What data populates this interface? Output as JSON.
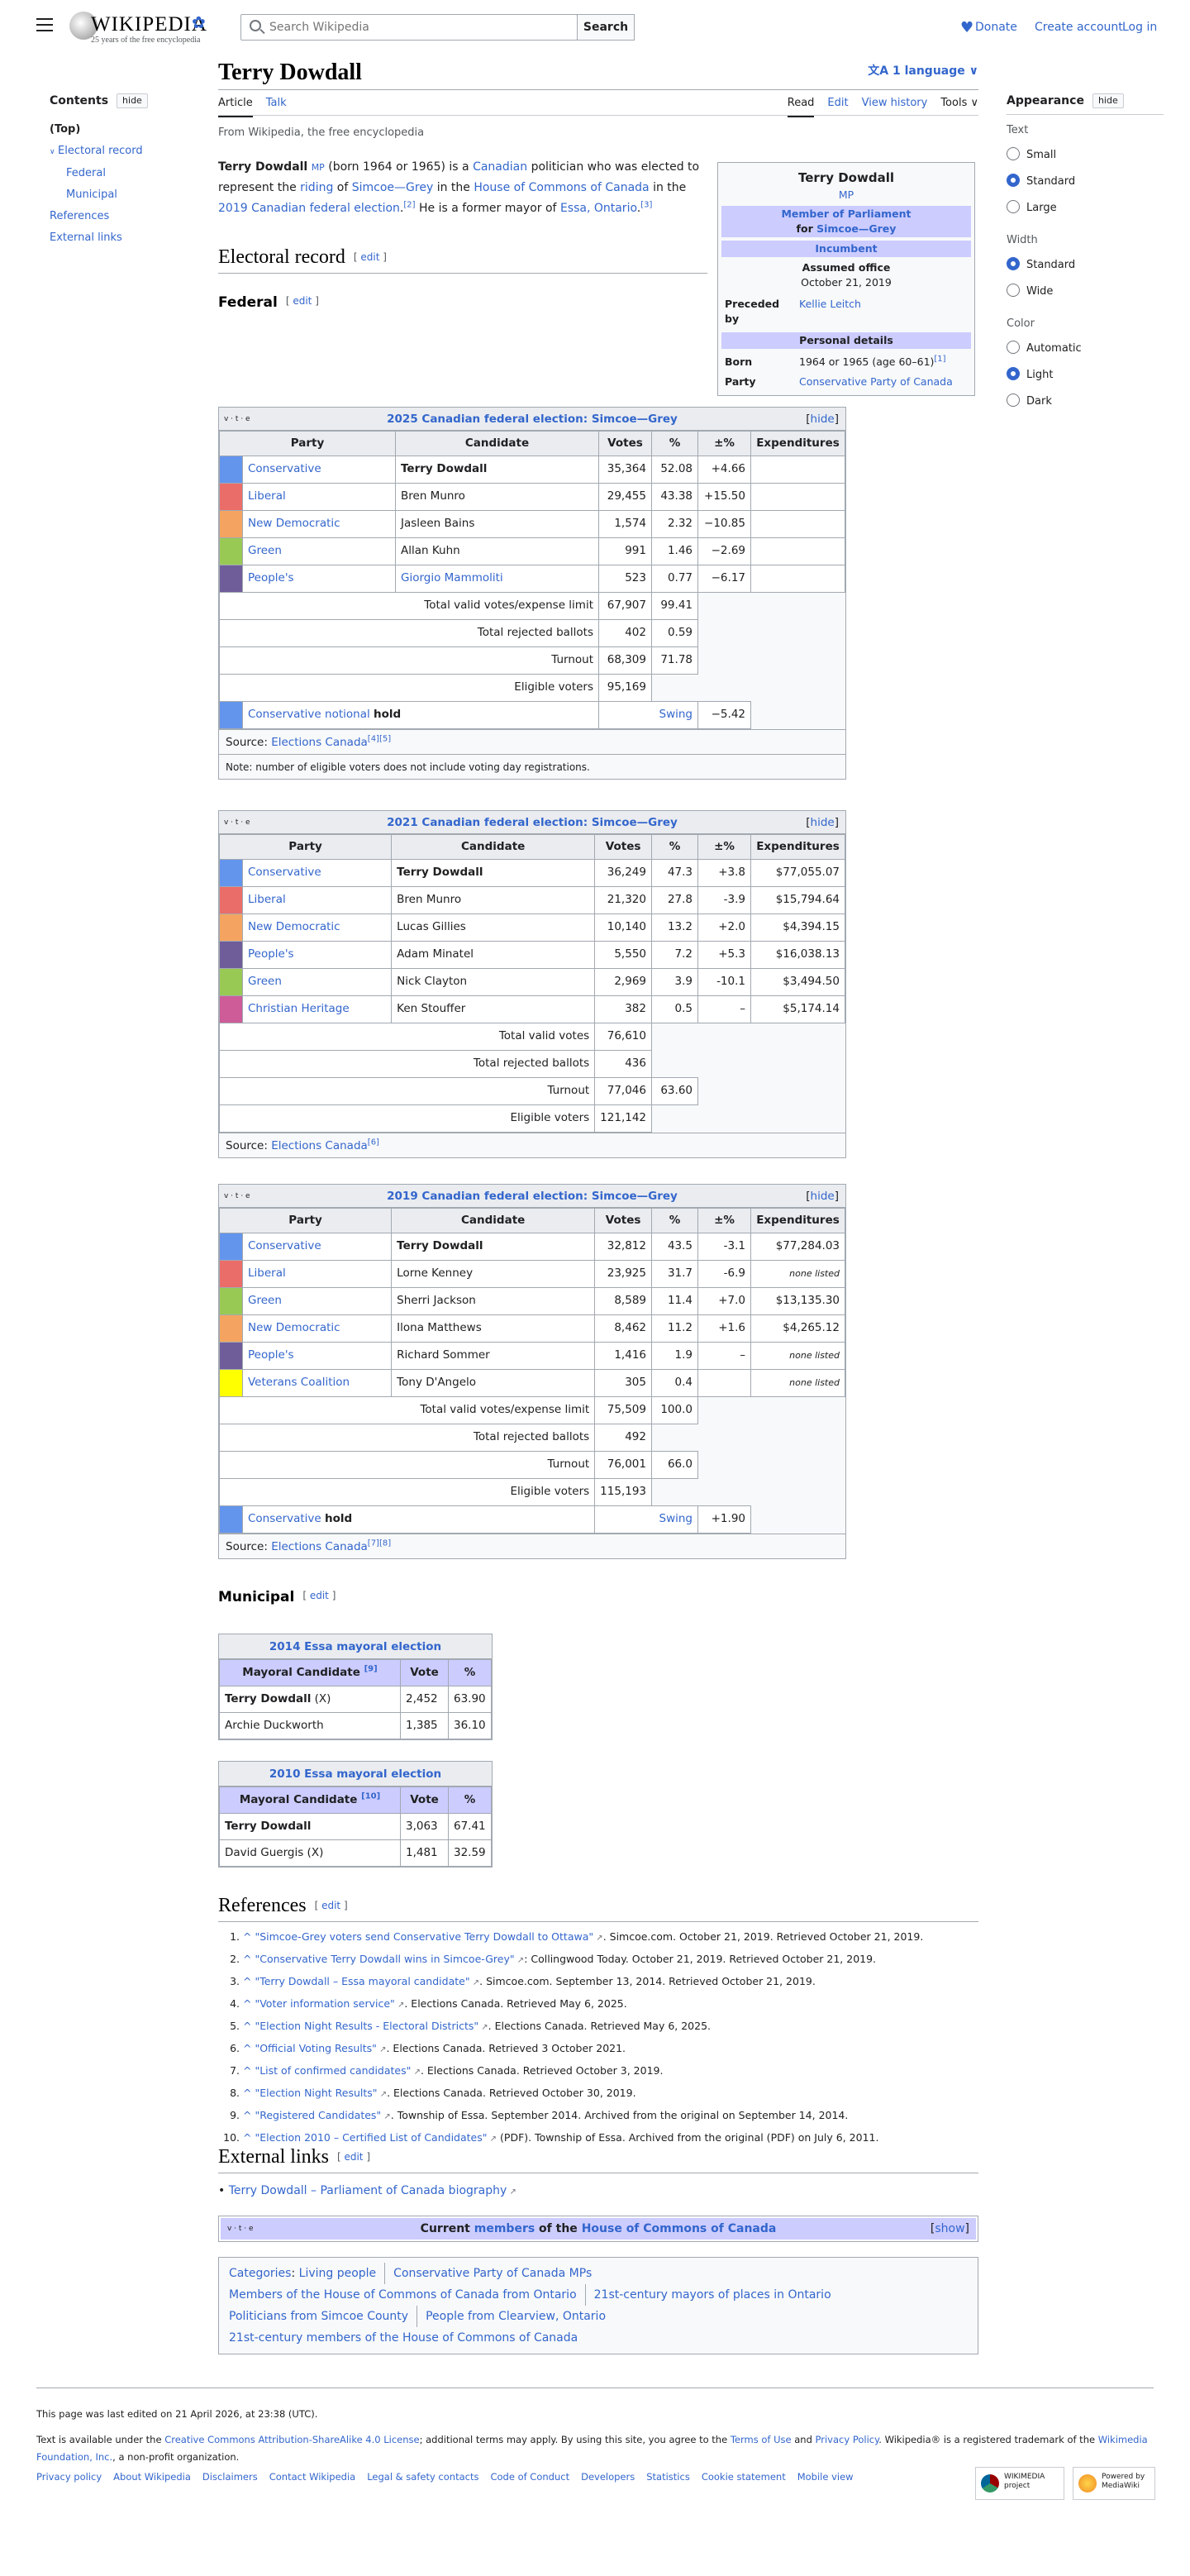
{
  "header": {
    "logo_word": "WIKIPEDIA",
    "logo_tagline": "25 years of the free encyclopedia",
    "search_placeholder": "Search Wikipedia",
    "search_button": "Search",
    "donate": "Donate",
    "create_account": "Create account",
    "login": "Log in"
  },
  "toc": {
    "title": "Contents",
    "hide": "hide",
    "items": [
      "(Top)",
      "Electoral record",
      "Federal",
      "Municipal",
      "References",
      "External links"
    ]
  },
  "appearance": {
    "title": "Appearance",
    "hide": "hide",
    "text_label": "Text",
    "text_options": [
      "Small",
      "Standard",
      "Large"
    ],
    "text_selected": "Standard",
    "width_label": "Width",
    "width_options": [
      "Standard",
      "Wide"
    ],
    "width_selected": "Standard",
    "color_label": "Color",
    "color_options": [
      "Automatic",
      "Light",
      "Dark"
    ],
    "color_selected": "Light"
  },
  "article": {
    "title": "Terry Dowdall",
    "languages": "1 language",
    "tab_article": "Article",
    "tab_talk": "Talk",
    "tab_read": "Read",
    "tab_edit": "Edit",
    "tab_history": "View history",
    "tab_tools": "Tools",
    "from": "From Wikipedia, the free encyclopedia",
    "lead": {
      "name": "Terry Dowdall",
      "mp": "MP",
      "t1": " (born 1964 or 1965) is a ",
      "canadian": "Canadian",
      "t2": " politician who was elected to represent the ",
      "riding": "riding",
      "t3": " of ",
      "sg": "Simcoe—Grey",
      "t4": " in the ",
      "hoc": "House of Commons of Canada",
      "t5": " in the ",
      "fed2019": "2019 Canadian federal election",
      "ref2": "[2]",
      "t6": " He is a former mayor of ",
      "essa": "Essa, Ontario",
      "ref3": "[3]"
    },
    "edit": "edit",
    "h_electoral": "Electoral record",
    "h_federal": "Federal",
    "h_municipal": "Municipal",
    "h_references": "References",
    "h_external": "External links"
  },
  "infobox": {
    "name": "Terry Dowdall",
    "mp": "MP",
    "office_l1": "Member of Parliament",
    "office_for": "for ",
    "office_riding": "Simcoe—Grey",
    "incumbent": "Incumbent",
    "assumed_label": "Assumed office",
    "assumed_date": "October 21, 2019",
    "preceded_label": "Preceded by",
    "preceded_value": "Kellie Leitch",
    "personal": "Personal details",
    "born_label": "Born",
    "born_value": "1964 or 1965 (age 60–61)",
    "born_ref": "[1]",
    "party_label": "Party",
    "party_value": "Conservative Party of Canada"
  },
  "vte": "v · t · e",
  "hide": "hide",
  "headers": {
    "party": "Party",
    "candidate": "Candidate",
    "votes": "Votes",
    "pct": "%",
    "delta": "±%",
    "exp": "Expenditures"
  },
  "e2025": {
    "caption": "2025 Canadian federal election: Simcoe—Grey",
    "rows": [
      {
        "party": "Conservative",
        "color": "#6495ED",
        "candidate": "Terry Dowdall",
        "votes": "35,364",
        "pct": "52.08",
        "delta": "+4.66",
        "exp": "",
        "bold": true
      },
      {
        "party": "Liberal",
        "color": "#EA6D6A",
        "candidate": "Bren Munro",
        "votes": "29,455",
        "pct": "43.38",
        "delta": "+15.50",
        "exp": ""
      },
      {
        "party": "New Democratic",
        "color": "#F4A460",
        "candidate": "Jasleen Bains",
        "votes": "1,574",
        "pct": "2.32",
        "delta": "−10.85",
        "exp": ""
      },
      {
        "party": "Green",
        "color": "#99C955",
        "candidate": "Allan Kuhn",
        "votes": "991",
        "pct": "1.46",
        "delta": "−2.69",
        "exp": ""
      },
      {
        "party": "People's",
        "color": "#6F5D9A",
        "candidate": "Giorgio Mammoliti",
        "votes": "523",
        "pct": "0.77",
        "delta": "−6.17",
        "exp": "",
        "link": true
      }
    ],
    "totals": [
      {
        "label": "Total valid votes/expense limit",
        "votes": "67,907",
        "pct": "99.41"
      },
      {
        "label": "Total rejected ballots",
        "votes": "402",
        "pct": "0.59"
      },
      {
        "label": "Turnout",
        "votes": "68,309",
        "pct": "71.78"
      },
      {
        "label": "Eligible voters",
        "votes": "95,169",
        "pct": ""
      }
    ],
    "hold_party": "Conservative",
    "hold_notional": "notional",
    "hold_word": "hold",
    "swing": "Swing",
    "swing_value": "−5.42",
    "source_label": "Source: ",
    "source_link": "Elections Canada",
    "source_refs": "[4][5]",
    "note": "Note: number of eligible voters does not include voting day registrations."
  },
  "e2021": {
    "caption": "2021 Canadian federal election: Simcoe—Grey",
    "rows": [
      {
        "party": "Conservative",
        "color": "#6495ED",
        "candidate": "Terry Dowdall",
        "votes": "36,249",
        "pct": "47.3",
        "delta": "+3.8",
        "exp": "$77,055.07",
        "bold": true
      },
      {
        "party": "Liberal",
        "color": "#EA6D6A",
        "candidate": "Bren Munro",
        "votes": "21,320",
        "pct": "27.8",
        "delta": "-3.9",
        "exp": "$15,794.64"
      },
      {
        "party": "New Democratic",
        "color": "#F4A460",
        "candidate": "Lucas Gillies",
        "votes": "10,140",
        "pct": "13.2",
        "delta": "+2.0",
        "exp": "$4,394.15"
      },
      {
        "party": "People's",
        "color": "#6F5D9A",
        "candidate": "Adam Minatel",
        "votes": "5,550",
        "pct": "7.2",
        "delta": "+5.3",
        "exp": "$16,038.13"
      },
      {
        "party": "Green",
        "color": "#99C955",
        "candidate": "Nick Clayton",
        "votes": "2,969",
        "pct": "3.9",
        "delta": "-10.1",
        "exp": "$3,494.50"
      },
      {
        "party": "Christian Heritage",
        "color": "#CD5C99",
        "candidate": "Ken Stouffer",
        "votes": "382",
        "pct": "0.5",
        "delta": "–",
        "exp": "$5,174.14"
      }
    ],
    "totals": [
      {
        "label": "Total valid votes",
        "votes": "76,610",
        "pct": ""
      },
      {
        "label": "Total rejected ballots",
        "votes": "436",
        "pct": ""
      },
      {
        "label": "Turnout",
        "votes": "77,046",
        "pct": "63.60"
      },
      {
        "label": "Eligible voters",
        "votes": "121,142",
        "pct": ""
      }
    ],
    "source_label": "Source: ",
    "source_link": "Elections Canada",
    "source_refs": "[6]"
  },
  "e2019": {
    "caption": "2019 Canadian federal election: Simcoe—Grey",
    "rows": [
      {
        "party": "Conservative",
        "color": "#6495ED",
        "candidate": "Terry Dowdall",
        "votes": "32,812",
        "pct": "43.5",
        "delta": "-3.1",
        "exp": "$77,284.03",
        "bold": true
      },
      {
        "party": "Liberal",
        "color": "#EA6D6A",
        "candidate": "Lorne Kenney",
        "votes": "23,925",
        "pct": "31.7",
        "delta": "-6.9",
        "exp": "none listed",
        "none": true
      },
      {
        "party": "Green",
        "color": "#99C955",
        "candidate": "Sherri Jackson",
        "votes": "8,589",
        "pct": "11.4",
        "delta": "+7.0",
        "exp": "$13,135.30"
      },
      {
        "party": "New Democratic",
        "color": "#F4A460",
        "candidate": "Ilona Matthews",
        "votes": "8,462",
        "pct": "11.2",
        "delta": "+1.6",
        "exp": "$4,265.12"
      },
      {
        "party": "People's",
        "color": "#6F5D9A",
        "candidate": "Richard Sommer",
        "votes": "1,416",
        "pct": "1.9",
        "delta": "–",
        "exp": "none listed",
        "none": true
      },
      {
        "party": "Veterans Coalition",
        "color": "#FFFF00",
        "candidate": "Tony D'Angelo",
        "votes": "305",
        "pct": "0.4",
        "delta": "",
        "exp": "none listed",
        "none": true
      }
    ],
    "totals": [
      {
        "label": "Total valid votes/expense limit",
        "votes": "75,509",
        "pct": "100.0"
      },
      {
        "label": "Total rejected ballots",
        "votes": "492",
        "pct": ""
      },
      {
        "label": "Turnout",
        "votes": "76,001",
        "pct": "66.0"
      },
      {
        "label": "Eligible voters",
        "votes": "115,193",
        "pct": ""
      }
    ],
    "hold_party": "Conservative",
    "hold_word": "hold",
    "swing": "Swing",
    "swing_value": "+1.90",
    "source_label": "Source: ",
    "source_link": "Elections Canada",
    "source_refs": "[7][8]"
  },
  "m2014": {
    "caption": "2014 Essa mayoral election",
    "h_cand": "Mayoral Candidate",
    "h_ref": "[9]",
    "h_vote": "Vote",
    "h_pct": "%",
    "rows": [
      {
        "name": "Terry Dowdall",
        "suffix": " (X)",
        "vote": "2,452",
        "pct": "63.90",
        "bold": true
      },
      {
        "name": "Archie Duckworth",
        "suffix": "",
        "vote": "1,385",
        "pct": "36.10"
      }
    ]
  },
  "m2010": {
    "caption": "2010 Essa mayoral election",
    "h_cand": "Mayoral Candidate",
    "h_ref": "[10]",
    "h_vote": "Vote",
    "h_pct": "%",
    "rows": [
      {
        "name": "Terry Dowdall",
        "suffix": "",
        "vote": "3,063",
        "pct": "67.41",
        "bold": true
      },
      {
        "name": "David Guergis",
        "suffix": " (X)",
        "vote": "1,481",
        "pct": "32.59"
      }
    ]
  },
  "references": [
    {
      "title": "\"Simcoe-Grey voters send Conservative Terry Dowdall to Ottawa\"",
      "rest": ". Simcoe.com. October 21, 2019. Retrieved October 21, 2019."
    },
    {
      "title": "\"Conservative Terry Dowdall wins in Simcoe-Grey\"",
      "rest": ": Collingwood Today. October 21, 2019. Retrieved October 21, 2019."
    },
    {
      "title": "\"Terry Dowdall – Essa mayoral candidate\"",
      "rest": ". Simcoe.com. September 13, 2014. Retrieved October 21, 2019."
    },
    {
      "title": "\"Voter information service\"",
      "rest": ". Elections Canada. Retrieved May 6, 2025."
    },
    {
      "title": "\"Election Night Results - Electoral Districts\"",
      "rest": ". Elections Canada. Retrieved May 6, 2025."
    },
    {
      "title": "\"Official Voting Results\"",
      "rest": ". Elections Canada. Retrieved 3 October 2021."
    },
    {
      "title": "\"List of confirmed candidates\"",
      "rest": ". Elections Canada. Retrieved October 3, 2019."
    },
    {
      "title": "\"Election Night Results\"",
      "rest": ". Elections Canada. Retrieved October 30, 2019."
    },
    {
      "title": "\"Registered Candidates\"",
      "rest": ". Township of Essa. September 2014. Archived from the original on September 14, 2014."
    },
    {
      "title": "\"Election 2010 – Certified List of Candidates\"",
      "rest": " (PDF). Township of Essa. Archived from the original (PDF) on July 6, 2011."
    }
  ],
  "external": {
    "link": "Terry Dowdall – Parliament of Canada biography"
  },
  "navbox": {
    "pre": "Current ",
    "members": "members",
    "mid": " of the ",
    "hoc": "House of Commons of Canada",
    "show": "show"
  },
  "categories": {
    "label": "Categories",
    "items": [
      "Living people",
      "Conservative Party of Canada MPs",
      "Members of the House of Commons of Canada from Ontario",
      "21st-century mayors of places in Ontario",
      "Politicians from Simcoe County",
      "People from Clearview, Ontario",
      "21st-century members of the House of Commons of Canada"
    ]
  },
  "footer": {
    "edited": "This page was last edited on 21 April 2026, at 23:38 (UTC).",
    "license_pre": "Text is available under the ",
    "license_link": "Creative Commons Attribution-ShareAlike 4.0 License",
    "license_mid": "; additional terms may apply. By using this site, you agree to the ",
    "terms": "Terms of Use",
    "and": " and ",
    "privacy": "Privacy Policy",
    "trademark": ". Wikipedia® is a registered trademark of the ",
    "foundation": "Wikimedia Foundation, Inc.",
    "nonprofit": ", a non-profit organization.",
    "links": [
      "Privacy policy",
      "About Wikipedia",
      "Disclaimers",
      "Contact Wikipedia",
      "Legal & safety contacts",
      "Code of Conduct",
      "Developers",
      "Statistics",
      "Cookie statement",
      "Mobile view"
    ],
    "badge1": "WIKIMEDIA project",
    "badge2": "Powered by MediaWiki"
  }
}
